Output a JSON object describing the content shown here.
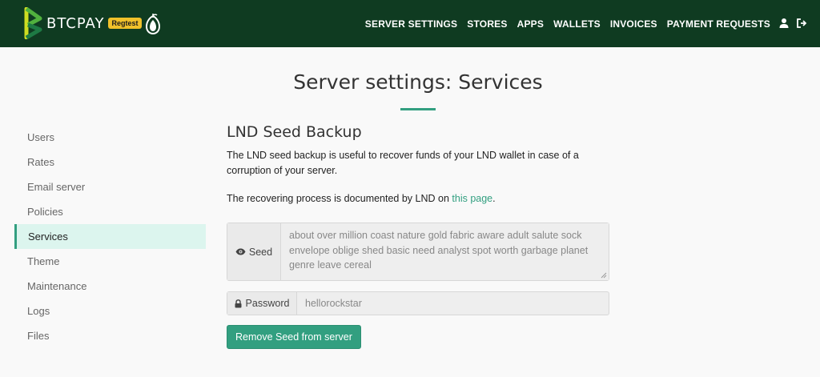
{
  "brand": {
    "name": "BTCPAY",
    "badge": "Regtest"
  },
  "nav": {
    "links": [
      "SERVER SETTINGS",
      "STORES",
      "APPS",
      "WALLETS",
      "INVOICES",
      "PAYMENT REQUESTS"
    ],
    "icons": [
      "user-icon",
      "logout-icon"
    ]
  },
  "page": {
    "title": "Server settings: Services"
  },
  "sidebar": {
    "items": [
      {
        "label": "Users"
      },
      {
        "label": "Rates"
      },
      {
        "label": "Email server"
      },
      {
        "label": "Policies"
      },
      {
        "label": "Services"
      },
      {
        "label": "Theme"
      },
      {
        "label": "Maintenance"
      },
      {
        "label": "Logs"
      },
      {
        "label": "Files"
      }
    ],
    "active": "Services"
  },
  "main": {
    "section_title": "LND Seed Backup",
    "description": "The LND seed backup is useful to recover funds of your LND wallet in case of a corruption of your server.",
    "recover_prefix": "The recovering process is documented by LND on ",
    "recover_link": "this page",
    "recover_suffix": ".",
    "seed_label": "Seed",
    "seed_value": "about over million coast nature gold fabric aware adult salute sock envelope oblige shed basic need analyst spot worth garbage planet genre leave cereal",
    "password_label": "Password",
    "password_value": "hellorockstar",
    "remove_button": "Remove Seed from server"
  },
  "colors": {
    "navbar": "#0f3b21",
    "accent": "#329f80",
    "badge": "#f0c12a",
    "active_bg": "#dcf5ee"
  }
}
